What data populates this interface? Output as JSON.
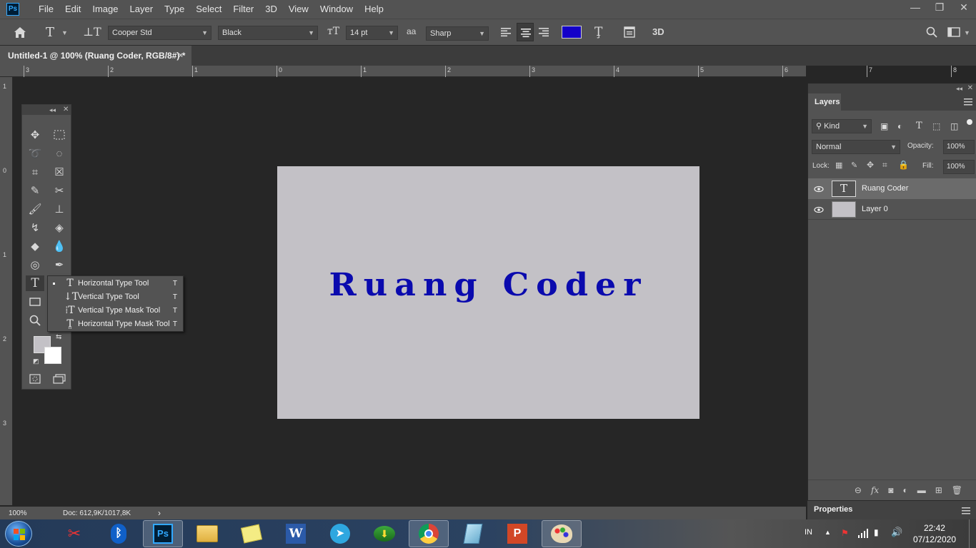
{
  "app": {
    "logo": "Ps"
  },
  "menu": [
    "File",
    "Edit",
    "Image",
    "Layer",
    "Type",
    "Select",
    "Filter",
    "3D",
    "View",
    "Window",
    "Help"
  ],
  "window_controls": {
    "minimize": "—",
    "restore": "❐",
    "close": "✕"
  },
  "options": {
    "font_family": "Cooper Std",
    "font_style": "Black",
    "font_size": "14 pt",
    "antialias_label": "aa",
    "antialias": "Sharp",
    "three_d": "3D",
    "text_color": "#1400c8"
  },
  "document_tab": {
    "title": "Untitled-1 @ 100% (Ruang Coder, RGB/8#) *",
    "close": "×"
  },
  "rulers": {
    "horizontal": [
      "3",
      "2",
      "1",
      "0",
      "1",
      "2",
      "3",
      "4",
      "5",
      "6",
      "7",
      "8"
    ],
    "vertical": [
      "1",
      "0",
      "1",
      "2",
      "3"
    ]
  },
  "canvas": {
    "text": "Ruang Coder",
    "background": "#c3c1c6",
    "text_color": "#0a0aae"
  },
  "flyout": [
    {
      "label": "Horizontal Type Tool",
      "key": "T",
      "icon": "T",
      "selected": true
    },
    {
      "label": "Vertical Type Tool",
      "key": "T",
      "icon": "↓T",
      "selected": false
    },
    {
      "label": "Vertical Type Mask Tool",
      "key": "T",
      "icon": "⁞T",
      "selected": false
    },
    {
      "label": "Horizontal Type Mask Tool",
      "key": "T",
      "icon": "T̤",
      "selected": false
    }
  ],
  "layers_panel": {
    "tab": "Layers",
    "filter": "Kind",
    "blend_mode": "Normal",
    "opacity_label": "Opacity:",
    "opacity": "100%",
    "lock_label": "Lock:",
    "fill_label": "Fill:",
    "fill": "100%",
    "layers": [
      {
        "name": "Ruang Coder",
        "type": "text",
        "selected": true
      },
      {
        "name": "Layer 0",
        "type": "pixel",
        "selected": false
      }
    ]
  },
  "properties_panel": {
    "tab": "Properties"
  },
  "status": {
    "zoom": "100%",
    "doc": "Doc: 612,9K/1017,8K",
    "arrow": "›"
  },
  "taskbar": {
    "lang": "IN",
    "time": "22:42",
    "date": "07/12/2020"
  }
}
